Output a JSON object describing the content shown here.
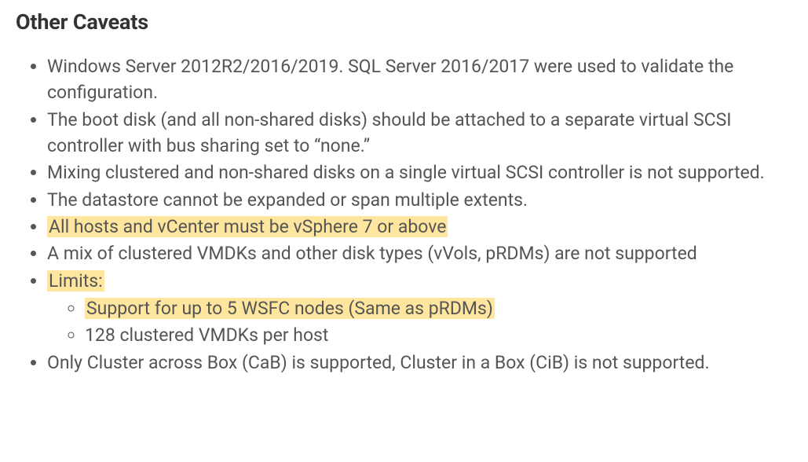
{
  "heading": "Other Caveats",
  "items": {
    "i1": "Windows Server 2012R2/2016/2019. SQL Server 2016/2017 were used to validate the configuration.",
    "i2": "The boot disk (and all non-shared disks) should be attached to a separate virtual SCSI controller with bus sharing set to “none.”",
    "i3": "Mixing clustered and non-shared disks on a single virtual SCSI controller is not supported.",
    "i4": "The datastore cannot be expanded or span multiple extents.",
    "i5": "All hosts and vCenter must be vSphere 7 or above",
    "i6": "A mix of clustered VMDKs and other disk types (vVols, pRDMs) are not supported",
    "i7": "Limits:",
    "i7a": "Support for up to 5 WSFC nodes (Same as pRDMs)",
    "i7b": "128 clustered VMDKs per host",
    "i8": "Only Cluster across Box (CaB) is supported, Cluster in a Box (CiB) is not supported."
  }
}
